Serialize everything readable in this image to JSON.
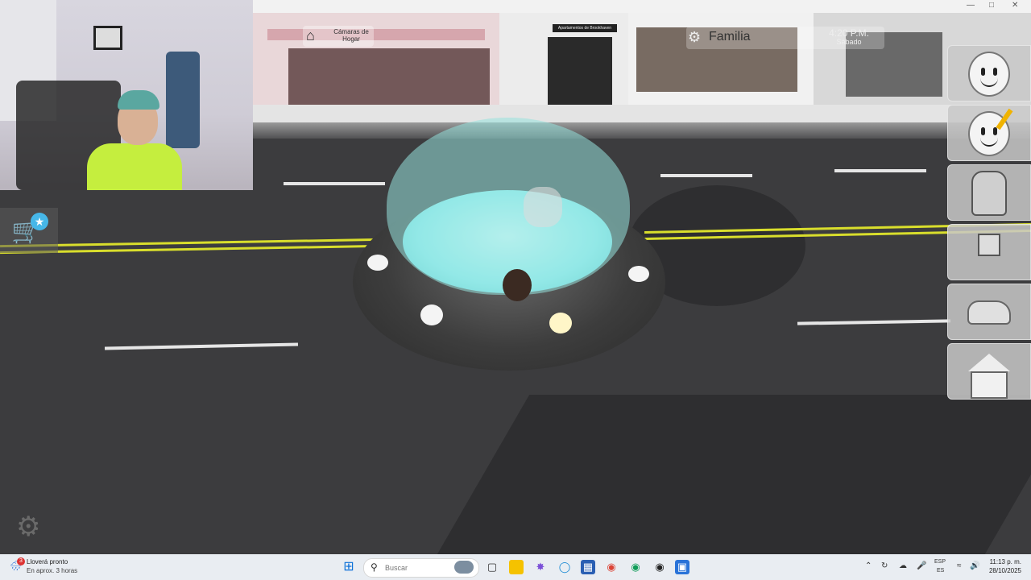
{
  "game": {
    "camera_button": {
      "label": "Cámaras de Hogar",
      "icon": "house-camera-icon"
    },
    "store_sign": "Apartamentos de Brookhaven",
    "team_label": "Familia",
    "time": "4:20 P.M.",
    "day": "Sábado",
    "right_menu": [
      {
        "name": "avatar-face-button",
        "icon": "smiley-face-icon"
      },
      {
        "name": "avatar-edit-button",
        "icon": "smiley-face-pencil-icon"
      },
      {
        "name": "backpack-button",
        "icon": "backpack-icon"
      },
      {
        "name": "roleplay-character-button",
        "icon": "character-icon"
      },
      {
        "name": "vehicle-button",
        "icon": "car-icon"
      },
      {
        "name": "house-button",
        "icon": "house-icon"
      }
    ],
    "shop_button": {
      "icon": "cart-star-icon"
    },
    "settings_button": {
      "icon": "gear-icon"
    }
  },
  "taskbar": {
    "weather_title": "Lloverá pronto",
    "weather_subtitle": "En aprox. 3 horas",
    "weather_badge": "3",
    "search_placeholder": "Buscar",
    "language_1": "ESP",
    "language_2": "ES",
    "clock_time": "11:13 p. m.",
    "clock_date": "28/10/2025",
    "colors": {
      "taskbar_bg": "#e9edf2",
      "start_blue": "#0a6fd8"
    }
  }
}
